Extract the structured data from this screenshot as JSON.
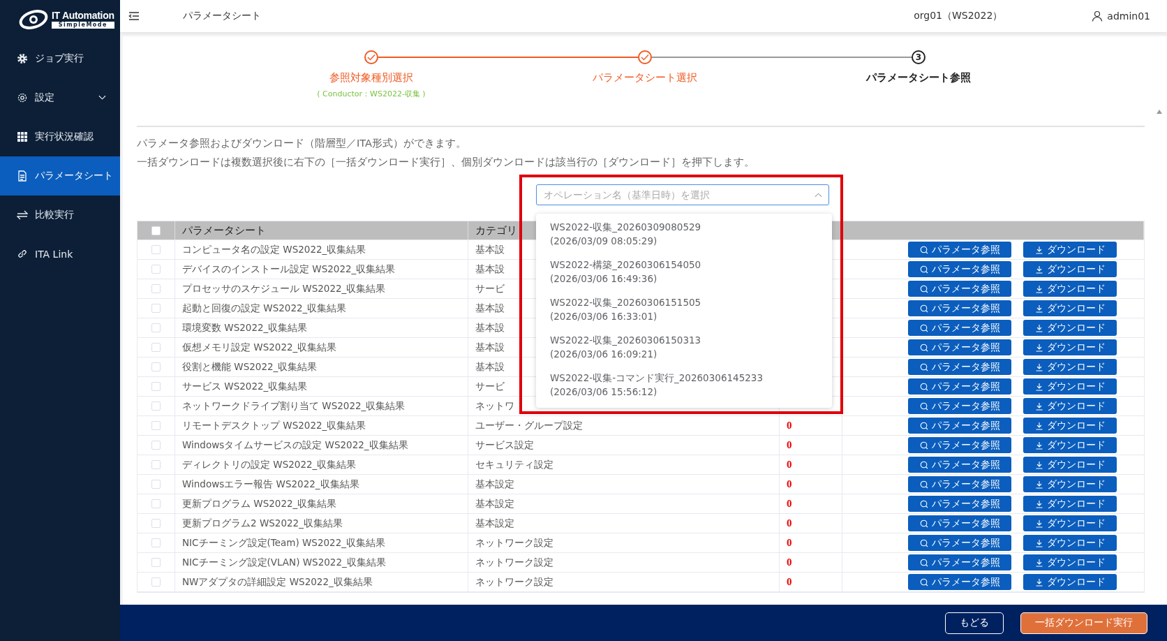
{
  "logo": {
    "title": "IT Automation",
    "subtitle": "SimpleMode"
  },
  "sidebar": {
    "items": [
      {
        "label": "ジョブ実行",
        "selected": false
      },
      {
        "label": "設定",
        "selected": false,
        "expanded": false
      },
      {
        "label": "実行状況確認",
        "selected": false
      },
      {
        "label": "パラメータシート",
        "selected": true
      },
      {
        "label": "比較実行",
        "selected": false
      },
      {
        "label": "ITA Link",
        "selected": false
      }
    ]
  },
  "header": {
    "title": "パラメータシート",
    "org": "org01（WS2022）",
    "user": "admin01"
  },
  "stepper": [
    {
      "label": "参照対象種別選択",
      "completed": true,
      "sub": "( Conductor：WS2022-収集 )"
    },
    {
      "label": "パラメータシート選択",
      "completed": true
    },
    {
      "label": "パラメータシート参照",
      "completed": false,
      "number": "3"
    }
  ],
  "description": [
    "パラメータ参照およびダウンロード（階層型／ITA形式）ができます。",
    "一括ダウンロードは複数選択後に右下の［一括ダウンロード実行］、個別ダウンロードは該当行の［ダウンロード］を押下します。"
  ],
  "operation_select": {
    "placeholder": "オペレーション名（基準日時）を選択",
    "expanded": true,
    "highlighted": true,
    "options": [
      {
        "name": "WS2022-収集_20260309080529",
        "date": "(2026/03/09 08:05:29)"
      },
      {
        "name": "WS2022-構築_20260306154050",
        "date": "(2026/03/06 16:49:36)"
      },
      {
        "name": "WS2022-収集_20260306151505",
        "date": "(2026/03/06 16:33:01)"
      },
      {
        "name": "WS2022-収集_20260306150313",
        "date": "(2026/03/06 16:09:21)"
      },
      {
        "name": "WS2022-収集-コマンド実行_20260306145233",
        "date": "(2026/03/06 15:56:12)"
      }
    ]
  },
  "table": {
    "columns": [
      "パラメータシート",
      "カテゴリ"
    ],
    "select_all": false,
    "rows": [
      {
        "checked": false,
        "name": "コンピュータ名の設定 WS2022_収集結果",
        "category": "基本設",
        "ref_button": "パラメータ参照",
        "download_button": "ダウンロード"
      },
      {
        "checked": false,
        "name": "デバイスのインストール設定 WS2022_収集結果",
        "category": "基本設",
        "ref_button": "パラメータ参照",
        "download_button": "ダウンロード"
      },
      {
        "checked": false,
        "name": "プロセッサのスケジュール WS2022_収集結果",
        "category": "サービ",
        "ref_button": "パラメータ参照",
        "download_button": "ダウンロード"
      },
      {
        "checked": false,
        "name": "起動と回復の設定 WS2022_収集結果",
        "category": "基本設",
        "ref_button": "パラメータ参照",
        "download_button": "ダウンロード"
      },
      {
        "checked": false,
        "name": "環境変数 WS2022_収集結果",
        "category": "基本設",
        "ref_button": "パラメータ参照",
        "download_button": "ダウンロード"
      },
      {
        "checked": false,
        "name": "仮想メモリ設定 WS2022_収集結果",
        "category": "基本設",
        "ref_button": "パラメータ参照",
        "download_button": "ダウンロード"
      },
      {
        "checked": false,
        "name": "役割と機能 WS2022_収集結果",
        "category": "基本設",
        "ref_button": "パラメータ参照",
        "download_button": "ダウンロード"
      },
      {
        "checked": false,
        "name": "サービス WS2022_収集結果",
        "category": "サービ",
        "ref_button": "パラメータ参照",
        "download_button": "ダウンロード"
      },
      {
        "checked": false,
        "name": "ネットワークドライブ割り当て WS2022_収集結果",
        "category": "ネットワ",
        "ref_button": "パラメータ参照",
        "download_button": "ダウンロード"
      },
      {
        "checked": false,
        "name": "リモートデスクトップ WS2022_収集結果",
        "category": "ユーザー・グループ設定",
        "count": "0",
        "ref_button": "パラメータ参照",
        "download_button": "ダウンロード"
      },
      {
        "checked": false,
        "name": "Windowsタイムサービスの設定 WS2022_収集結果",
        "category": "サービス設定",
        "count": "0",
        "ref_button": "パラメータ参照",
        "download_button": "ダウンロード"
      },
      {
        "checked": false,
        "name": "ディレクトリの設定 WS2022_収集結果",
        "category": "セキュリティ設定",
        "count": "0",
        "ref_button": "パラメータ参照",
        "download_button": "ダウンロード"
      },
      {
        "checked": false,
        "name": "Windowsエラー報告 WS2022_収集結果",
        "category": "基本設定",
        "count": "0",
        "ref_button": "パラメータ参照",
        "download_button": "ダウンロード"
      },
      {
        "checked": false,
        "name": "更新プログラム WS2022_収集結果",
        "category": "基本設定",
        "count": "0",
        "ref_button": "パラメータ参照",
        "download_button": "ダウンロード"
      },
      {
        "checked": false,
        "name": "更新プログラム2 WS2022_収集結果",
        "category": "基本設定",
        "count": "0",
        "ref_button": "パラメータ参照",
        "download_button": "ダウンロード"
      },
      {
        "checked": false,
        "name": "NICチーミング設定(Team) WS2022_収集結果",
        "category": "ネットワーク設定",
        "count": "0",
        "ref_button": "パラメータ参照",
        "download_button": "ダウンロード"
      },
      {
        "checked": false,
        "name": "NICチーミング設定(VLAN) WS2022_収集結果",
        "category": "ネットワーク設定",
        "count": "0",
        "ref_button": "パラメータ参照",
        "download_button": "ダウンロード"
      },
      {
        "checked": false,
        "name": "NWアダプタの詳細設定 WS2022_収集結果",
        "category": "ネットワーク設定",
        "count": "0",
        "ref_button": "パラメータ参照",
        "download_button": "ダウンロード"
      }
    ]
  },
  "footer": {
    "back": "もどる",
    "bulk_download": "一括ダウンロード実行"
  }
}
